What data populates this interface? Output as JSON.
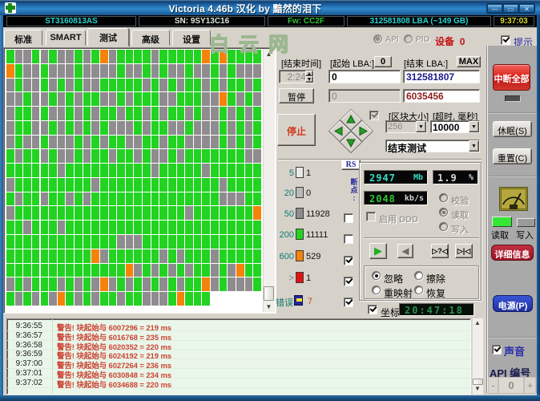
{
  "window": {
    "title": "Victoria 4.46b 汉化 by 黯然的泪下",
    "minimize": "—",
    "maximize": "▭",
    "close": "✕"
  },
  "info_bar": {
    "model": "ST3160813AS",
    "serial": "SN: 9SY13C16",
    "firmware": "Fw: CC2F",
    "capacity": "312581808 LBA (~149 GB)",
    "time": "9:37:03"
  },
  "watermark": "白云网",
  "tabs": {
    "items": [
      "标准",
      "SMART",
      "测试",
      "高级",
      "设置"
    ],
    "active": "测试",
    "api_label": "API",
    "pio_label": "PIO",
    "device_label": "设备",
    "device_number": "0",
    "hint_label": "提示"
  },
  "scan": {
    "end_time_label": "[结束时间]",
    "end_time_value": "2:24",
    "start_lba_label": "[起始 LBA:]",
    "start_lba_button": "0",
    "start_lba_value": "0",
    "end_lba_label": "[结束 LBA:]",
    "end_lba_button": "MAX",
    "end_lba_value": "312581807",
    "current_lba_shadow": "0",
    "current_lba_value": "6035456",
    "pause_button": "暂停",
    "stop_button": "停止",
    "block_size_label": "[区块大小]",
    "block_size_value": "256",
    "timeout_label": "[超时, 毫秒]",
    "timeout_value": "10000",
    "action_value": "结束测试"
  },
  "legend": {
    "rs_button": "RS",
    "side_label": "断点:",
    "rows": [
      {
        "label": "5",
        "count": "1",
        "color": "#e9e9e9"
      },
      {
        "label": "20",
        "count": "0",
        "color": "#bcbabc"
      },
      {
        "label": "50",
        "count": "11928",
        "color": "#8e8c8e"
      },
      {
        "label": "200",
        "count": "11111",
        "color": "#22d322"
      },
      {
        "label": "600",
        "count": "529",
        "color": "#f5820a"
      },
      {
        "label": ">",
        "count": "1",
        "color": "#e01212"
      }
    ],
    "error_label": "错误",
    "error_count": "7",
    "checkboxes": [
      false,
      false,
      true,
      true,
      true
    ]
  },
  "stats": {
    "mb_value": "2947",
    "mb_unit": "Mb",
    "percent_value": "1.9",
    "percent_unit": "%",
    "speed_value": "2048",
    "speed_unit": "kb/s",
    "ddd_label": "启用",
    "ddd_suffix": "DDD",
    "mode_options": [
      "校验",
      "读取",
      "写入"
    ],
    "mode_selected": "读取",
    "play_button": "▶",
    "back_button": "◀",
    "seek_button": "▷?◁",
    "step_button": "▷|◁"
  },
  "actions": {
    "options": [
      {
        "label": "忽略",
        "selected": true
      },
      {
        "label": "擦除",
        "selected": false
      },
      {
        "label": "重映射",
        "selected": false
      },
      {
        "label": "恢复",
        "selected": false
      }
    ],
    "coords_label": "坐标",
    "clock": "20:47:18"
  },
  "side_panel": {
    "break_all": "中断全部",
    "sleep": "休眠(S)",
    "recall": "重置(C)",
    "read_led_label": "读取",
    "write_led_label": "写入",
    "details": "详细信息",
    "power": "电源(P)",
    "sound_label": "声音",
    "api_number_label": "API 编号",
    "api_minus": "-",
    "api_value": "0",
    "api_plus": "+"
  },
  "log": {
    "rows": [
      {
        "time": "9:36:55",
        "message": "警告! 块起始与 6007296 = 219 ms"
      },
      {
        "time": "9:36:57",
        "message": "警告! 块起始与 6016768 = 235 ms"
      },
      {
        "time": "9:36:58",
        "message": "警告! 块起始与 6020352 = 220 ms"
      },
      {
        "time": "9:36:59",
        "message": "警告! 块起始与 6024192 = 219 ms"
      },
      {
        "time": "9:37:00",
        "message": "警告! 块起始与 6027264 = 236 ms"
      },
      {
        "time": "9:37:01",
        "message": "警告! 块起始与 6030848 = 234 ms"
      },
      {
        "time": "9:37:02",
        "message": "警告! 块起始与 6034688 = 220 ms"
      }
    ]
  },
  "grid": {
    "colors": {
      "G": "#22d322",
      "g": "#8e8c8e",
      "O": "#f5820a"
    },
    "rows": [
      "GggGgGggGgGOgGGGGgGGGGGOGOGGGG",
      "OGggGgggGggggGggGgGggGggGgGggg",
      "gGggGgGgGggGGGGGgGgGgGGgGgGGgG",
      "ggGggGgGgGGggGgGGGggGGGggOGgGg",
      "gGGgGggGgGgGGgGGgGgGGgGggGgGgG",
      "gGGggGgGgGgGgggGgGGggGgggGgGgG",
      "gGggGgggGgGgGGggGGgGGggggGgGgG",
      "GgGGgGggGgGGgGGgGggGgGGGGGGGgg",
      "GGGGGGgGGGGGGGGGGgGGGGGgGGGGGG",
      "gGGGGGGGGGgGGGGGGGGGGGGGGgGGGG",
      "GgGGgGGgGgGGGGGGGGGGGGGGGgggGG",
      "gGGGGGGGGGGGGGGGGGGGGgGGGGGGGO",
      "GGgGGGgGGGGGGGGGGGGGGGGGGGGGGG",
      "GGGGGGGGGGGGGgggGGGGGGGGGGGGGG",
      "GGGGGGGGGGOgGGGGGGgGgGGGgGGGGG",
      "GGGGGGGGGGGGGGOgGgGgGgGGgGgOGG",
      "gGgGGGgGgGgOgGgGgGgGgGGOgGgggG",
      "GgGgGgOGgGgGGgGGgggGOGGG"
    ]
  }
}
